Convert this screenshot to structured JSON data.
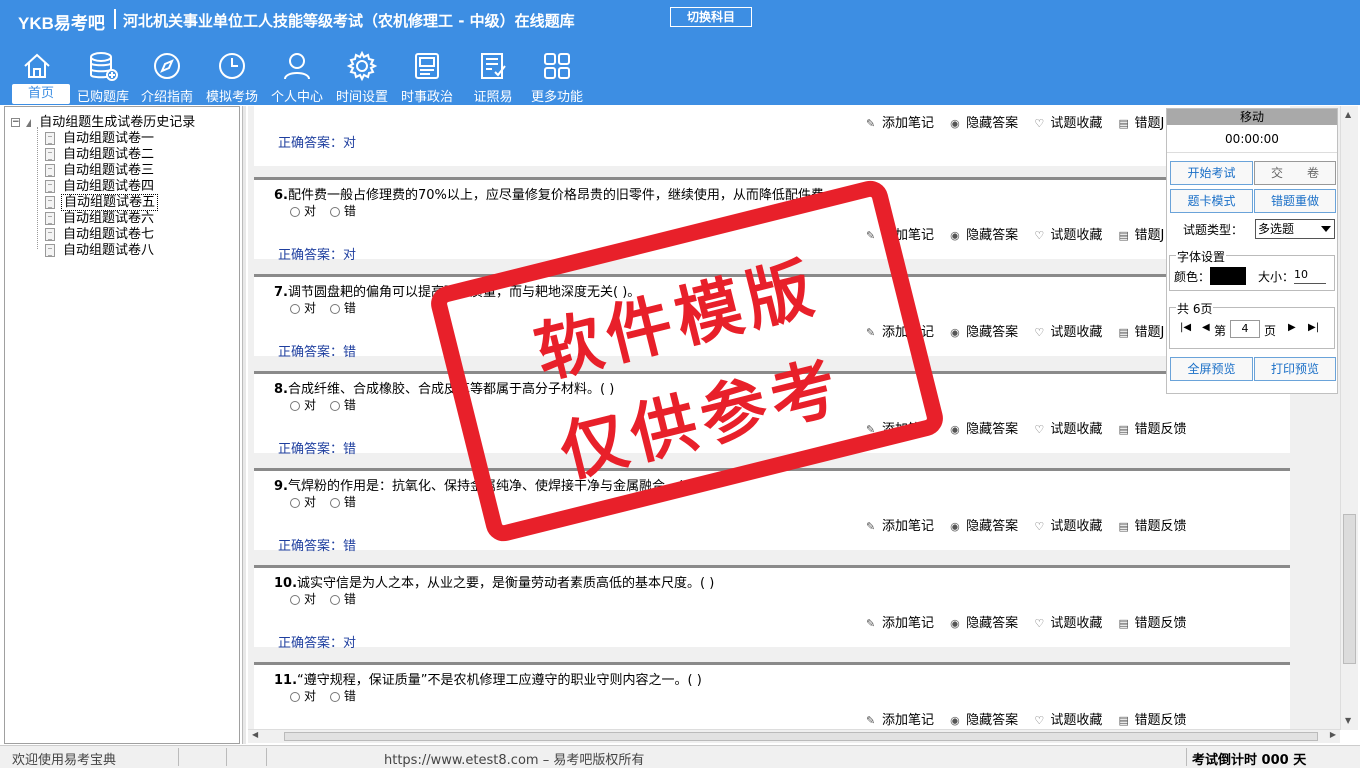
{
  "header": {
    "logo": "YKB易考吧",
    "title": "河北机关事业单位工人技能等级考试（农机修理工 - 中级）在线题库",
    "switch_button": "切换科目"
  },
  "nav": [
    {
      "label": "首页",
      "icon": "home-icon"
    },
    {
      "label": "已购题库",
      "icon": "database-icon"
    },
    {
      "label": "介绍指南",
      "icon": "compass-icon"
    },
    {
      "label": "模拟考场",
      "icon": "clock-icon"
    },
    {
      "label": "个人中心",
      "icon": "user-icon"
    },
    {
      "label": "时间设置",
      "icon": "gear-icon"
    },
    {
      "label": "时事政治",
      "icon": "news-icon"
    },
    {
      "label": "证照易",
      "icon": "certificate-icon"
    },
    {
      "label": "更多功能",
      "icon": "grid-icon"
    }
  ],
  "tree": {
    "root": "自动组题生成试卷历史记录",
    "items": [
      "自动组题试卷一",
      "自动组题试卷二",
      "自动组题试卷三",
      "自动组题试卷四",
      "自动组题试卷五",
      "自动组题试卷六",
      "自动组题试卷七",
      "自动组题试卷八"
    ],
    "selected": "自动组题试卷五"
  },
  "options": {
    "true": "对",
    "false": "错"
  },
  "actions": {
    "note": "添加笔记",
    "hide": "隐藏答案",
    "favorite": "试题收藏",
    "feedback": "错题反馈",
    "feedback_cut": "错题J"
  },
  "answer_prefix": "正确答案：",
  "questions": [
    {
      "num": "",
      "text": "",
      "answer": "对"
    },
    {
      "num": "6.",
      "text": "配件费一般占修理费的70%以上，应尽量修复价格昂贵的旧零件，继续使用，从而降低配件费。( )",
      "answer": "对"
    },
    {
      "num": "7.",
      "text": "调节圆盘耙的偏角可以提高碎土质量，而与耙地深度无关( )。",
      "answer": "错"
    },
    {
      "num": "8.",
      "text": "合成纤维、合成橡胶、合成皮革等都属于高分子材料。( )",
      "answer": "错"
    },
    {
      "num": "9.",
      "text": "气焊粉的作用是：抗氧化、保持金属纯净、使焊接干净与金属融合。( )",
      "answer": "错"
    },
    {
      "num": "10.",
      "text": "诚实守信是为人之本，从业之要，是衡量劳动者素质高低的基本尺度。( )",
      "answer": "对"
    },
    {
      "num": "11.",
      "text": "“遵守规程，保证质量”不是农机修理工应遵守的职业守则内容之一。( )",
      "answer": ""
    }
  ],
  "control": {
    "move": "移动",
    "timer": "00:00:00",
    "start_exam": "开始考试",
    "submit": "交　　卷",
    "card_mode": "题卡模式",
    "redo_wrong": "错题重做",
    "qtype_label": "试题类型：",
    "qtype_value": "多选题",
    "font_legend": "字体设置",
    "color_label": "颜色：",
    "size_label": "大小：",
    "size_value": "10",
    "page_legend": "共 6页",
    "page_prefix": "第",
    "page_value": "4",
    "page_suffix": "页",
    "fullscreen": "全屏预览",
    "print": "打印预览",
    "font_color": "#000000"
  },
  "stamp": {
    "line1": "软件模版",
    "line2": "仅供参考"
  },
  "footer": {
    "welcome": "欢迎使用易考宝典",
    "site": "https://www.etest8.com – 易考吧版权所有",
    "countdown": "考试倒计时 000 天"
  },
  "colors": {
    "header": "#3d8ee3",
    "answer": "#1f3f9f",
    "stamp": "#e8202a"
  }
}
